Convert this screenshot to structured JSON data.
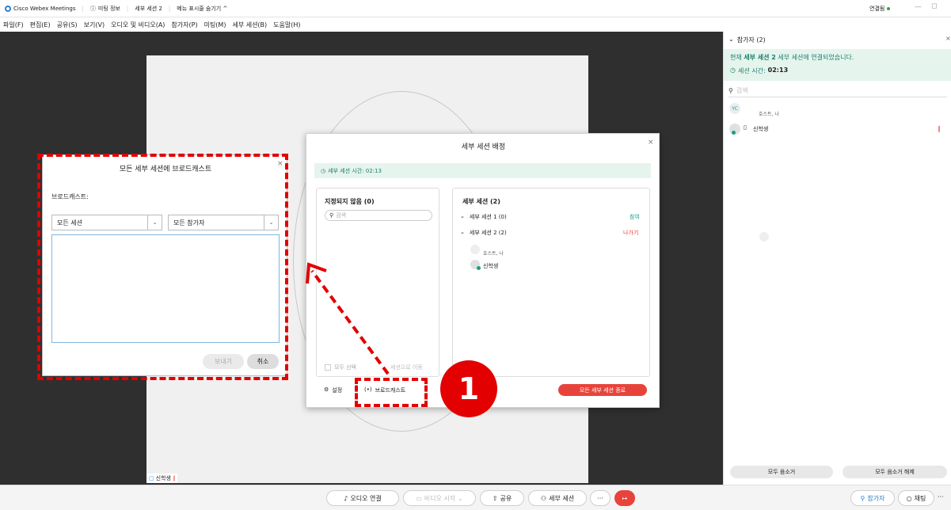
{
  "titlebar": {
    "app_name": "Cisco Webex Meetings",
    "meeting_info": "미팅 정보",
    "session": "세부 세션 2",
    "hide_menu": "메뉴 표시줄 숨기기 ^",
    "connected": "연결됨"
  },
  "menubar": {
    "items": [
      "파일(F)",
      "편집(E)",
      "공유(S)",
      "보기(V)",
      "오디오 및 비디오(A)",
      "참가자(P)",
      "미팅(M)",
      "세부 세션(B)",
      "도움말(H)"
    ]
  },
  "stage": {
    "name_chip": "신학생"
  },
  "right_panel": {
    "header": "참가자 (2)",
    "connected_prefix": "현재 ",
    "connected_bold": "세부 세션 2",
    "connected_suffix": " 세부 세션에 연결되었습니다.",
    "timer_label": "세션 시간:",
    "timer_value": "02:13",
    "search_placeholder": "검색",
    "participants": [
      {
        "initials": "YC",
        "name": "호스트, 나"
      },
      {
        "initials": "",
        "name": "신학생"
      }
    ],
    "mute_all": "모두 음소거",
    "unmute_all": "모두 음소거 해제"
  },
  "assign_dialog": {
    "title": "세부 세션 배정",
    "timer": "세부 세션 시간: 02:13",
    "unassigned_header": "지정되지 않음 (0)",
    "search_placeholder": "검색",
    "select_all": "모두 선택",
    "move_to_session": "세션으로 이동",
    "sessions_header": "세부 세션 (2)",
    "session1": "세부 세션 1 (0)",
    "session1_action": "참여",
    "session2": "세부 세션 2 (2)",
    "session2_action": "나가기",
    "member1": "호스트, 나",
    "member2": "신학생",
    "settings": "설정",
    "broadcast": "브로드캐스트",
    "end_all": "모든 세부 세션 종료"
  },
  "broadcast_dialog": {
    "title": "모든 세부 세션에 브로드캐스트",
    "label": "브로드캐스트:",
    "target_session": "모든 세션",
    "target_participant": "모든 참가자",
    "message_value": "",
    "send": "보내기",
    "cancel": "취소"
  },
  "annotation": {
    "step_number": "1"
  },
  "bottombar": {
    "audio": "오디오 연결",
    "video": "비디오 시작",
    "share": "공유",
    "breakout": "세부 세션",
    "participants": "참가자",
    "chat": "채팅"
  },
  "colors": {
    "accent": "#1a9e86",
    "danger": "#e8433a",
    "annotation": "#e20000"
  }
}
